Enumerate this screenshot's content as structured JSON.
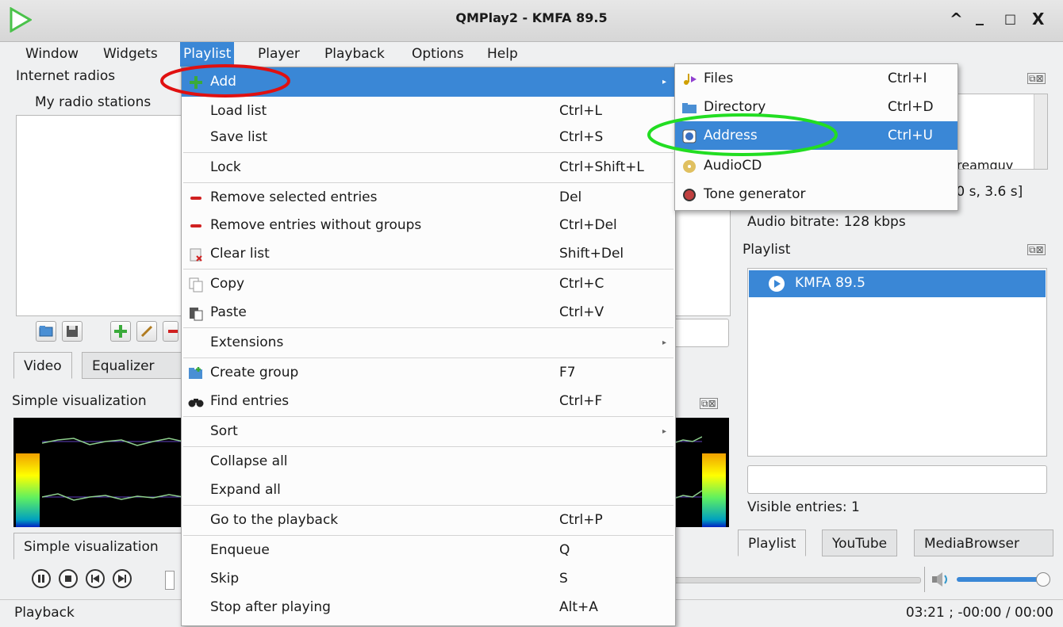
{
  "window": {
    "title": "QMPlay2 - KMFA 89.5",
    "controls": [
      "^",
      "_",
      "□",
      "X"
    ],
    "logo_color": "#4ac24a"
  },
  "menubar": [
    "Window",
    "Widgets",
    "Playlist",
    "Player",
    "Playback",
    "Options",
    "Help"
  ],
  "left_panel": {
    "title": "Internet radios",
    "subtitle": "My radio stations"
  },
  "tabs_left": [
    "Video",
    "Equalizer"
  ],
  "visualization": {
    "title": "Simple visualization",
    "tab": "Simple visualization"
  },
  "playlist_menu": {
    "items": [
      {
        "label": "Add",
        "shortcut": "",
        "submenu": true,
        "highlighted": true,
        "icon": "plus-icon"
      },
      {
        "label": "Load list",
        "shortcut": "Ctrl+L"
      },
      {
        "label": "Save list",
        "shortcut": "Ctrl+S"
      },
      {
        "label": "Lock",
        "shortcut": "Ctrl+Shift+L"
      },
      {
        "label": "Remove selected entries",
        "shortcut": "Del",
        "icon": "remove-icon"
      },
      {
        "label": "Remove entries without groups",
        "shortcut": "Ctrl+Del",
        "icon": "remove-icon"
      },
      {
        "label": "Clear list",
        "shortcut": "Shift+Del",
        "icon": "clear-icon"
      },
      {
        "label": "Copy",
        "shortcut": "Ctrl+C",
        "icon": "copy-icon"
      },
      {
        "label": "Paste",
        "shortcut": "Ctrl+V",
        "icon": "paste-icon"
      },
      {
        "label": "Extensions",
        "shortcut": "",
        "submenu": true
      },
      {
        "label": "Create group",
        "shortcut": "F7",
        "icon": "folder-new-icon"
      },
      {
        "label": "Find entries",
        "shortcut": "Ctrl+F",
        "icon": "binoculars-icon"
      },
      {
        "label": "Sort",
        "shortcut": "",
        "submenu": true
      },
      {
        "label": "Collapse all",
        "shortcut": ""
      },
      {
        "label": "Expand all",
        "shortcut": ""
      },
      {
        "label": "Go to the playback",
        "shortcut": "Ctrl+P"
      },
      {
        "label": "Enqueue",
        "shortcut": "Q"
      },
      {
        "label": "Skip",
        "shortcut": "S"
      },
      {
        "label": "Stop after playing",
        "shortcut": "Alt+A"
      }
    ]
  },
  "add_submenu": {
    "items": [
      {
        "label": "Files",
        "shortcut": "Ctrl+I"
      },
      {
        "label": "Directory",
        "shortcut": "Ctrl+D"
      },
      {
        "label": "Address",
        "shortcut": "Ctrl+U",
        "highlighted": true
      },
      {
        "label": "AudioCD",
        "shortcut": ""
      },
      {
        "label": "Tone generator",
        "shortcut": ""
      }
    ]
  },
  "info_panel": {
    "time_text": ".0 s, 3.6 s]",
    "partial_text": "reamguy",
    "audio_bitrate": "Audio bitrate: 128 kbps"
  },
  "playlist_panel": {
    "title": "Playlist",
    "entry": "KMFA 89.5",
    "visible_entries": "Visible entries: 1",
    "tabs": [
      "Playlist",
      "YouTube",
      "MediaBrowser"
    ]
  },
  "statusbar": {
    "left": "Playback",
    "right": "03:21 ; -00:00 / 00:00"
  },
  "annotations": {
    "red_ellipse_color": "#e01010",
    "green_ellipse_color": "#22dd22"
  }
}
